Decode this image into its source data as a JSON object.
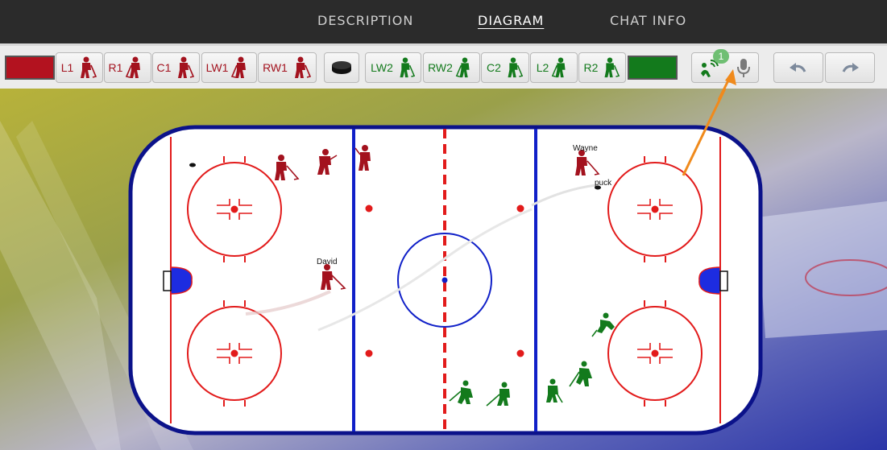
{
  "nav": {
    "tabs": [
      {
        "label": "DESCRIPTION",
        "active": false
      },
      {
        "label": "DIAGRAM",
        "active": true
      },
      {
        "label": "CHAT INFO",
        "active": false
      }
    ]
  },
  "toolbar": {
    "team_red_color": "#b3121f",
    "team_green_color": "#137a1c",
    "red_players": [
      "L1",
      "R1",
      "C1",
      "LW1",
      "RW1"
    ],
    "green_players": [
      "LW2",
      "RW2",
      "C2",
      "L2",
      "R2"
    ],
    "puck_icon": "puck-icon",
    "comment_badge_count": "1",
    "comment_icon": "comments-icon",
    "mic_icon": "microphone-icon",
    "undo_icon": "undo-icon",
    "redo_icon": "redo-icon"
  },
  "rink": {
    "labels": {
      "david": "David",
      "wayne": "Wayne",
      "puck": "puck"
    },
    "colors": {
      "board": "#0b128a",
      "blue_line": "#1020c8",
      "red_line": "#e21b1b",
      "crease": "#1d2ce0"
    }
  },
  "annotation": {
    "arrow_color": "#f08a1c"
  }
}
